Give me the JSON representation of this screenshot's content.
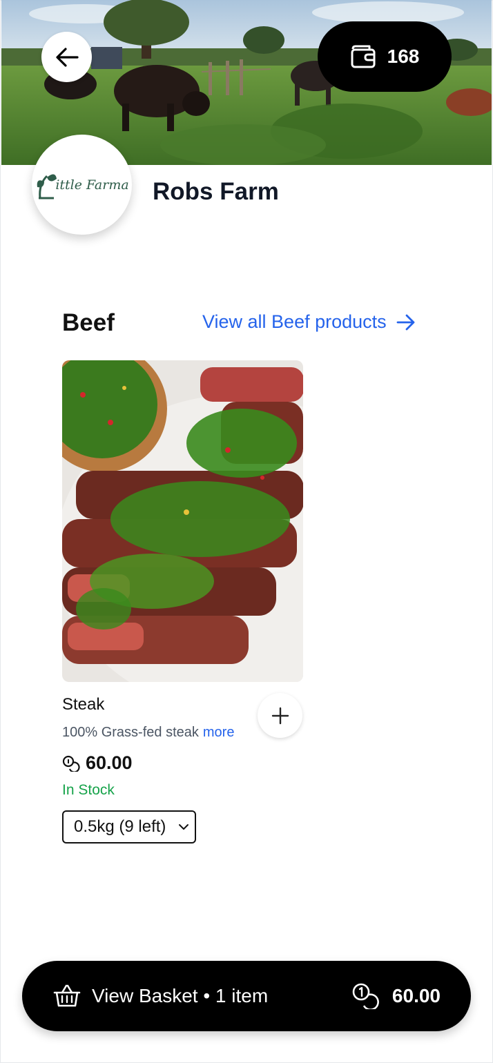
{
  "header": {
    "wallet_balance": "168",
    "hero_image": "farm-cattle-pasture-photo"
  },
  "farm": {
    "name": "Robs Farm",
    "logo_text": "ittle Farma",
    "logo_initial": "L"
  },
  "section": {
    "title": "Beef",
    "view_all_label": "View all Beef products"
  },
  "product": {
    "name": "Steak",
    "description": "100% Grass-fed steak",
    "more_label": "more",
    "price": "60.00",
    "stock_status": "In Stock",
    "selected_option": "0.5kg (9 left)",
    "image": "sliced-steak-chimichurri-photo"
  },
  "basket": {
    "label": "View Basket • 1 item",
    "total": "60.00"
  },
  "icons": {
    "back": "arrow-left-icon",
    "wallet": "wallet-icon",
    "view_all": "arrow-right-icon",
    "add": "plus-icon",
    "coin": "coins-icon",
    "dropdown": "chevron-down-icon",
    "basket": "basket-icon"
  },
  "colors": {
    "accent": "#2563eb",
    "in_stock": "#16a34a",
    "dark": "#000000",
    "logo_green": "#2f5d4a"
  }
}
